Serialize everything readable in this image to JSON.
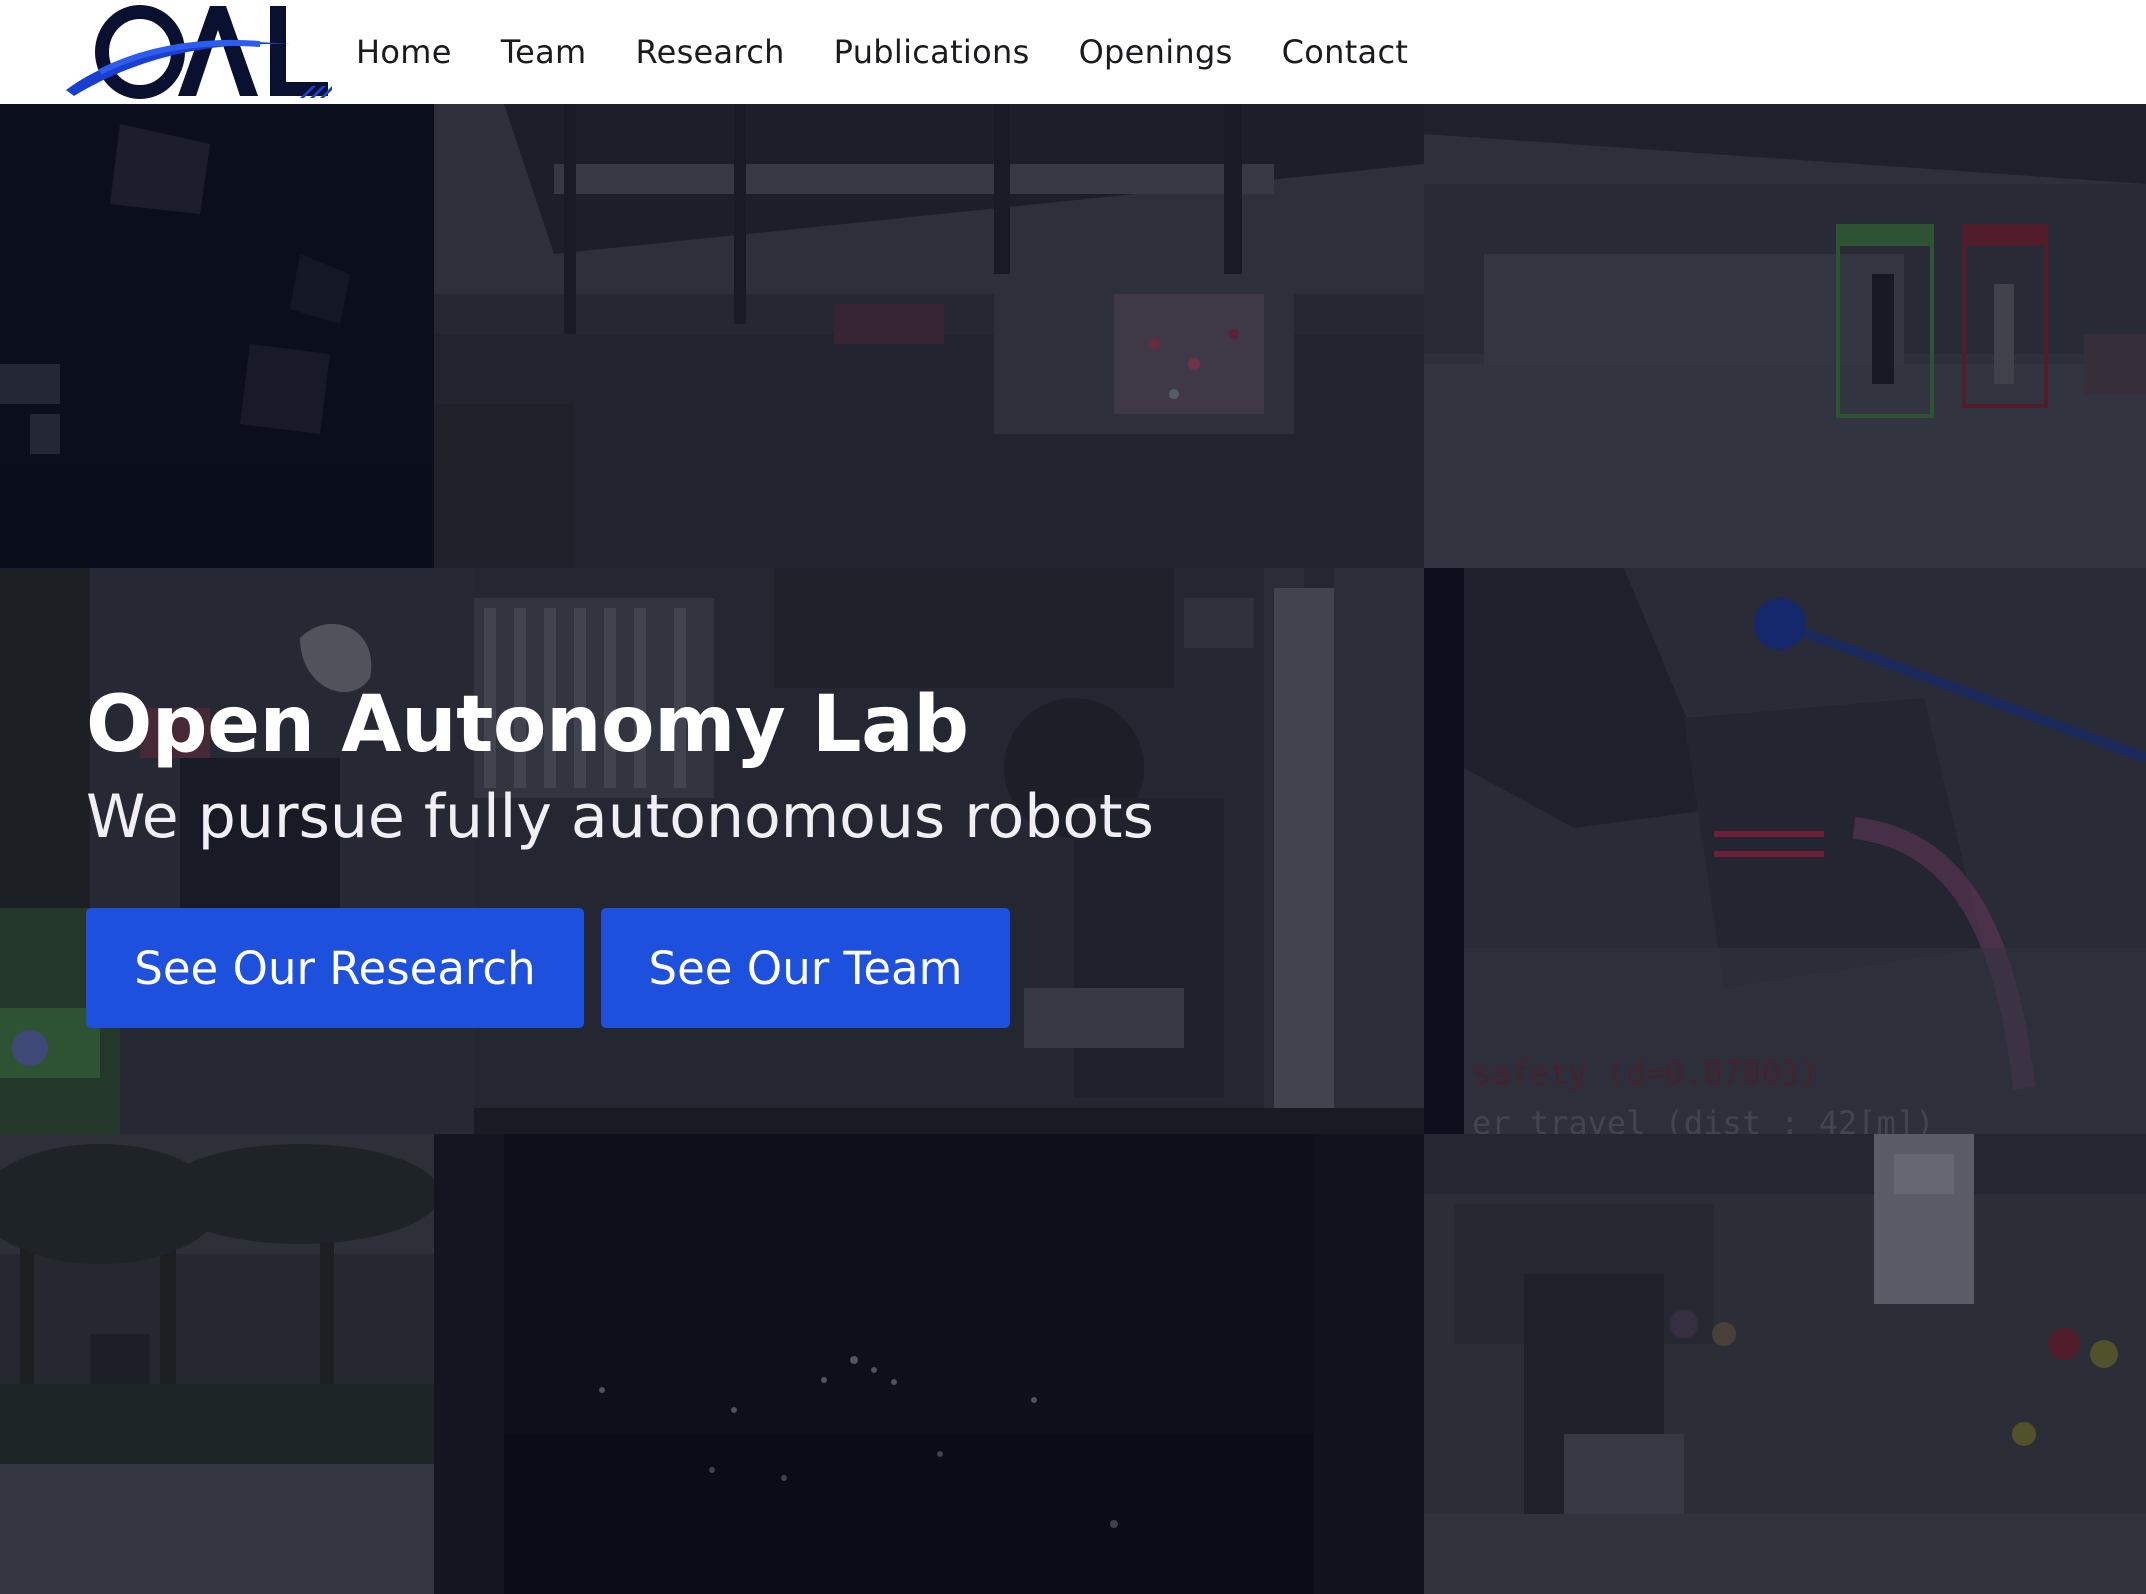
{
  "logo": {
    "text": "OAL"
  },
  "nav": {
    "items": [
      {
        "label": "Home"
      },
      {
        "label": "Team"
      },
      {
        "label": "Research"
      },
      {
        "label": "Publications"
      },
      {
        "label": "Openings"
      },
      {
        "label": "Contact"
      }
    ]
  },
  "hero": {
    "title": "Open Autonomy Lab",
    "subtitle": "We pursue fully autonomous robots",
    "buttons": {
      "research": "See Our Research",
      "team": "See Our Team"
    },
    "overlay_text": {
      "line1": "safety (d=0.07003)",
      "line2": "er travel (dist : 42[m])"
    }
  },
  "colors": {
    "button_blue": "#1e50de",
    "logo_navy": "#0a1e8c",
    "nav_text": "#1b1b1f"
  }
}
